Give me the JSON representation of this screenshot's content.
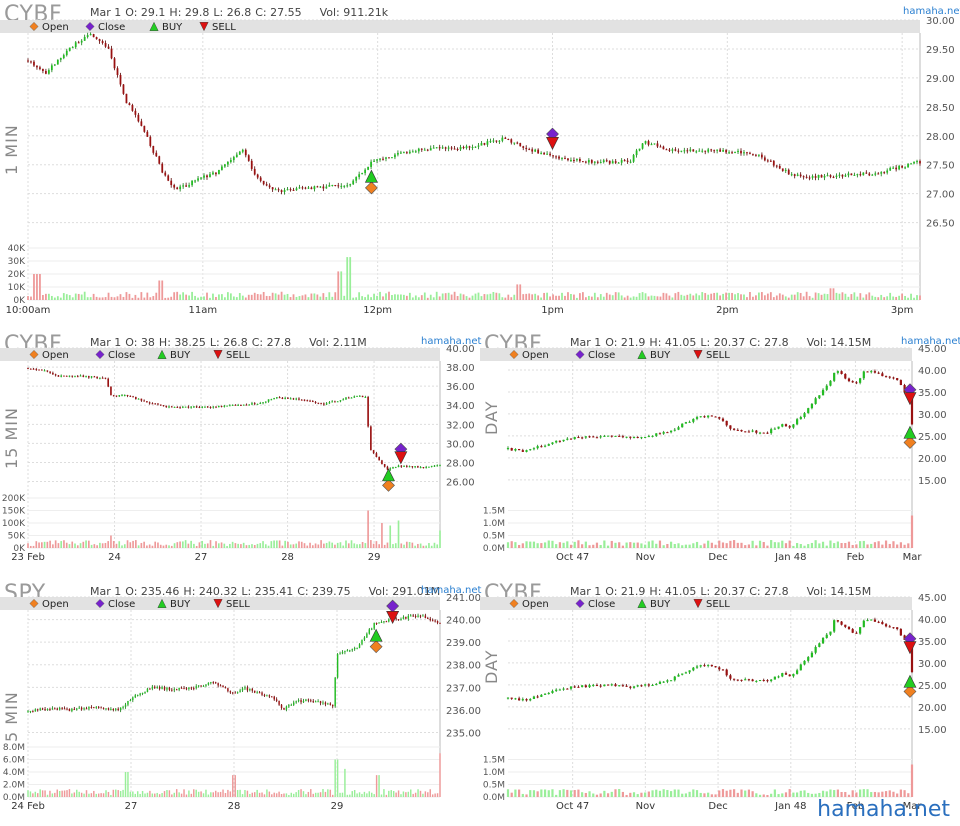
{
  "legend": {
    "open": "Open",
    "close": "Close",
    "buy": "BUY",
    "sell": "SELL"
  },
  "colors": {
    "up_candle": "#22bb22",
    "down_candle": "#991111",
    "up_volume": "#99ee99",
    "down_volume": "#ee9999",
    "open_marker": "#f08020",
    "close_marker": "#7722cc",
    "buy_marker": "#22cc22",
    "sell_marker": "#dd1111",
    "grid": "#dddddd",
    "legend_bg": "#e2e2e2"
  },
  "footer_brand": "hamaha.net",
  "chart_data": [
    {
      "id": "p1",
      "type": "candlestick",
      "ticker": "CYBF",
      "interval": "1 MIN",
      "ohlc": {
        "date": "Mar 1",
        "o": "O: 29.1",
        "h": "H: 29.8",
        "l": "L: 26.8",
        "c": "C: 27.55",
        "vol": "Vol: 911.21k"
      },
      "brand": "hamaha.net",
      "ylim": [
        26.2,
        30.0
      ],
      "y_ticks": [
        "30.00",
        "29.50",
        "29.00",
        "28.50",
        "28.00",
        "27.50",
        "27.00",
        "26.50"
      ],
      "y_tick_values": [
        30.0,
        29.5,
        29.0,
        28.5,
        28.0,
        27.5,
        27.0,
        26.5
      ],
      "x_ticks": [
        "10:00am",
        "11am",
        "12pm",
        "1pm",
        "2pm",
        "3pm"
      ],
      "x_tick_positions": [
        0,
        0.196,
        0.392,
        0.588,
        0.784,
        0.98
      ],
      "vol_max": 40000,
      "vol_ticks": [
        "40K",
        "30K",
        "20K",
        "10K",
        "0K"
      ],
      "vol_tick_values": [
        40000,
        30000,
        20000,
        10000,
        0
      ],
      "n_bars": 300,
      "path": [
        [
          0,
          29.3
        ],
        [
          0.02,
          29.1
        ],
        [
          0.05,
          29.55
        ],
        [
          0.07,
          29.75
        ],
        [
          0.09,
          29.5
        ],
        [
          0.11,
          28.6
        ],
        [
          0.13,
          28.1
        ],
        [
          0.15,
          27.4
        ],
        [
          0.165,
          27.05
        ],
        [
          0.19,
          27.25
        ],
        [
          0.21,
          27.35
        ],
        [
          0.24,
          27.75
        ],
        [
          0.26,
          27.2
        ],
        [
          0.28,
          27.05
        ],
        [
          0.32,
          27.1
        ],
        [
          0.36,
          27.15
        ],
        [
          0.385,
          27.55
        ],
        [
          0.43,
          27.75
        ],
        [
          0.49,
          27.8
        ],
        [
          0.535,
          27.95
        ],
        [
          0.565,
          27.75
        ],
        [
          0.6,
          27.6
        ],
        [
          0.64,
          27.55
        ],
        [
          0.675,
          27.55
        ],
        [
          0.69,
          27.9
        ],
        [
          0.72,
          27.75
        ],
        [
          0.78,
          27.75
        ],
        [
          0.82,
          27.65
        ],
        [
          0.86,
          27.3
        ],
        [
          0.9,
          27.3
        ],
        [
          0.95,
          27.35
        ],
        [
          1.0,
          27.55
        ]
      ],
      "noise": 0.06,
      "vol_spikes": [
        [
          0.01,
          20000
        ],
        [
          0.36,
          33000
        ],
        [
          0.35,
          22000
        ],
        [
          0.15,
          15000
        ],
        [
          0.55,
          12000
        ],
        [
          0.9,
          9000
        ]
      ],
      "markers": [
        {
          "kind": "open",
          "x": 0.385,
          "y": 27.1
        },
        {
          "kind": "buy",
          "x": 0.385,
          "y": 27.3
        },
        {
          "kind": "close",
          "x": 0.588,
          "y": 28.03
        },
        {
          "kind": "sell",
          "x": 0.588,
          "y": 27.87
        }
      ]
    },
    {
      "id": "p2",
      "type": "candlestick",
      "ticker": "CYBF",
      "interval": "15 MIN",
      "ohlc": {
        "date": "Mar 1",
        "o": "O: 38",
        "h": "H: 38.25",
        "l": "L: 26.8",
        "c": "C: 27.8",
        "vol": "Vol: 2.11M"
      },
      "brand": "hamaha.net",
      "ylim": [
        24.8,
        40.0
      ],
      "y_ticks": [
        "40.00",
        "38.00",
        "36.00",
        "34.00",
        "32.00",
        "30.00",
        "28.00",
        "26.00"
      ],
      "y_tick_values": [
        40,
        38,
        36,
        34,
        32,
        30,
        28,
        26
      ],
      "x_ticks": [
        "23 Feb",
        "24",
        "27",
        "28",
        "29"
      ],
      "x_tick_positions": [
        0.0,
        0.21,
        0.42,
        0.63,
        0.84
      ],
      "vol_max": 200000,
      "vol_ticks": [
        "200K",
        "150K",
        "100K",
        "50K",
        "0K"
      ],
      "vol_tick_values": [
        200000,
        150000,
        100000,
        50000,
        0
      ],
      "n_bars": 150,
      "path": [
        [
          0,
          37.9
        ],
        [
          0.04,
          37.6
        ],
        [
          0.07,
          37.0
        ],
        [
          0.12,
          37.1
        ],
        [
          0.19,
          36.8
        ],
        [
          0.2,
          35.0
        ],
        [
          0.24,
          35.0
        ],
        [
          0.3,
          34.2
        ],
        [
          0.34,
          33.8
        ],
        [
          0.45,
          33.8
        ],
        [
          0.56,
          34.2
        ],
        [
          0.6,
          34.8
        ],
        [
          0.66,
          34.6
        ],
        [
          0.72,
          34.1
        ],
        [
          0.76,
          34.6
        ],
        [
          0.8,
          35.0
        ],
        [
          0.82,
          34.8
        ],
        [
          0.825,
          32.0
        ],
        [
          0.83,
          29.5
        ],
        [
          0.85,
          28.3
        ],
        [
          0.87,
          27.3
        ],
        [
          0.9,
          27.6
        ],
        [
          0.93,
          27.6
        ],
        [
          0.96,
          27.4
        ],
        [
          1.0,
          27.8
        ]
      ],
      "noise": 0.18,
      "vol_spikes": [
        [
          0.825,
          150000
        ],
        [
          0.86,
          100000
        ],
        [
          0.88,
          90000
        ],
        [
          0.9,
          110000
        ],
        [
          0.2,
          50000
        ],
        [
          0.6,
          30000
        ],
        [
          1.0,
          70000
        ]
      ],
      "markers": [
        {
          "kind": "open",
          "x": 0.875,
          "y": 25.6
        },
        {
          "kind": "buy",
          "x": 0.875,
          "y": 26.7
        },
        {
          "kind": "close",
          "x": 0.905,
          "y": 29.4
        },
        {
          "kind": "sell",
          "x": 0.905,
          "y": 28.5
        }
      ]
    },
    {
      "id": "p3",
      "type": "candlestick",
      "ticker": "CYBF",
      "interval": "DAY",
      "ohlc": {
        "date": "Mar 1",
        "o": "O: 21.9",
        "h": "H: 41.05",
        "l": "L: 20.37",
        "c": "C: 27.8",
        "vol": "Vol: 14.15M"
      },
      "brand": "hamaha.net",
      "ylim": [
        12.0,
        45.0
      ],
      "y_ticks": [
        "45.00",
        "40.00",
        "35.00",
        "30.00",
        "25.00",
        "20.00",
        "15.00"
      ],
      "y_tick_values": [
        45,
        40,
        35,
        30,
        25,
        20,
        15
      ],
      "x_ticks": [
        "Oct 47",
        "Nov",
        "Dec",
        "Jan 48",
        "Feb",
        "Mar"
      ],
      "x_tick_positions": [
        0.16,
        0.34,
        0.52,
        0.7,
        0.86,
        1.0
      ],
      "vol_max": 2000000,
      "vol_ticks": [
        "1.5M",
        "1.0M",
        "0.5M",
        "0.0M"
      ],
      "vol_tick_values": [
        1500000,
        1000000,
        500000,
        0
      ],
      "n_bars": 110,
      "path": [
        [
          0,
          22.0
        ],
        [
          0.04,
          21.5
        ],
        [
          0.08,
          22.6
        ],
        [
          0.14,
          24.3
        ],
        [
          0.2,
          24.8
        ],
        [
          0.26,
          25.0
        ],
        [
          0.3,
          24.5
        ],
        [
          0.36,
          25.2
        ],
        [
          0.4,
          26.0
        ],
        [
          0.43,
          27.5
        ],
        [
          0.47,
          29.2
        ],
        [
          0.5,
          29.5
        ],
        [
          0.53,
          28.5
        ],
        [
          0.55,
          26.5
        ],
        [
          0.6,
          26.0
        ],
        [
          0.64,
          25.8
        ],
        [
          0.68,
          27.5
        ],
        [
          0.7,
          27.0
        ],
        [
          0.74,
          31.0
        ],
        [
          0.78,
          35.5
        ],
        [
          0.8,
          37.5
        ],
        [
          0.81,
          40.2
        ],
        [
          0.83,
          38.5
        ],
        [
          0.86,
          36.5
        ],
        [
          0.88,
          39.5
        ],
        [
          0.9,
          40.0
        ],
        [
          0.93,
          38.5
        ],
        [
          0.96,
          38.2
        ],
        [
          0.99,
          34.0
        ],
        [
          1.0,
          27.8
        ]
      ],
      "noise": 0.5,
      "vol_spikes": [
        [
          1.0,
          1300000
        ],
        [
          0.78,
          250000
        ],
        [
          0.8,
          300000
        ],
        [
          0.83,
          200000
        ]
      ],
      "markers": [
        {
          "kind": "open",
          "x": 0.995,
          "y": 23.5
        },
        {
          "kind": "buy",
          "x": 0.995,
          "y": 25.8
        },
        {
          "kind": "close",
          "x": 0.995,
          "y": 35.5
        },
        {
          "kind": "sell",
          "x": 0.995,
          "y": 33.5
        }
      ]
    },
    {
      "id": "p4",
      "type": "candlestick",
      "ticker": "SPY",
      "interval": "5 MIN",
      "ohlc": {
        "date": "Mar 1",
        "o": "O: 235.46",
        "h": "H: 240.32",
        "l": "L: 235.41",
        "c": "C: 239.75",
        "vol": "Vol: 291.01M"
      },
      "brand": "hamaha.net",
      "ylim": [
        234.8,
        241.0
      ],
      "y_ticks": [
        "241.00",
        "240.00",
        "239.00",
        "238.00",
        "237.00",
        "236.00",
        "235.00"
      ],
      "y_tick_values": [
        241,
        240,
        239,
        238,
        237,
        236,
        235
      ],
      "x_ticks": [
        "24 Feb",
        "27",
        "28",
        "29"
      ],
      "x_tick_positions": [
        0.0,
        0.25,
        0.5,
        0.75
      ],
      "vol_max": 8000000,
      "vol_ticks": [
        "8.0M",
        "6.0M",
        "4.0M",
        "2.0M",
        "0.0M"
      ],
      "vol_tick_values": [
        8000000,
        6000000,
        4000000,
        2000000,
        0
      ],
      "n_bars": 170,
      "path": [
        [
          0,
          235.9
        ],
        [
          0.05,
          236.1
        ],
        [
          0.1,
          236.0
        ],
        [
          0.15,
          236.1
        ],
        [
          0.22,
          236.0
        ],
        [
          0.25,
          236.5
        ],
        [
          0.3,
          237.0
        ],
        [
          0.35,
          236.9
        ],
        [
          0.4,
          237.0
        ],
        [
          0.45,
          237.2
        ],
        [
          0.5,
          236.7
        ],
        [
          0.52,
          237.0
        ],
        [
          0.6,
          236.5
        ],
        [
          0.62,
          236.0
        ],
        [
          0.65,
          236.4
        ],
        [
          0.7,
          236.4
        ],
        [
          0.74,
          236.2
        ],
        [
          0.75,
          238.4
        ],
        [
          0.8,
          238.8
        ],
        [
          0.82,
          239.3
        ],
        [
          0.84,
          239.8
        ],
        [
          0.88,
          240.0
        ],
        [
          0.92,
          240.1
        ],
        [
          0.95,
          240.2
        ],
        [
          1.0,
          239.8
        ]
      ],
      "noise": 0.12,
      "vol_spikes": [
        [
          1.0,
          7000000
        ],
        [
          0.75,
          6000000
        ],
        [
          0.24,
          4000000
        ],
        [
          0.5,
          3500000
        ],
        [
          0.77,
          4500000
        ],
        [
          0.85,
          3500000
        ]
      ],
      "markers": [
        {
          "kind": "open",
          "x": 0.845,
          "y": 238.8
        },
        {
          "kind": "buy",
          "x": 0.845,
          "y": 239.3
        },
        {
          "kind": "close",
          "x": 0.885,
          "y": 240.6
        },
        {
          "kind": "sell",
          "x": 0.885,
          "y": 240.1
        }
      ]
    },
    {
      "id": "p5",
      "type": "candlestick",
      "ticker": "CYBF",
      "interval": "DAY",
      "ohlc": {
        "date": "Mar 1",
        "o": "O: 21.9",
        "h": "H: 41.05",
        "l": "L: 20.37",
        "c": "C: 27.8",
        "vol": "Vol: 14.15M"
      },
      "brand": "hamaha.net",
      "ylim": [
        12.0,
        45.0
      ],
      "y_ticks": [
        "45.00",
        "40.00",
        "35.00",
        "30.00",
        "25.00",
        "20.00",
        "15.00"
      ],
      "y_tick_values": [
        45,
        40,
        35,
        30,
        25,
        20,
        15
      ],
      "x_ticks": [
        "Oct 47",
        "Nov",
        "Dec",
        "Jan 48",
        "Feb",
        "Mar"
      ],
      "x_tick_positions": [
        0.16,
        0.34,
        0.52,
        0.7,
        0.86,
        1.0
      ],
      "vol_max": 2000000,
      "vol_ticks": [
        "1.5M",
        "1.0M",
        "0.5M",
        "0.0M"
      ],
      "vol_tick_values": [
        1500000,
        1000000,
        500000,
        0
      ],
      "n_bars": 110,
      "path": [
        [
          0,
          22.0
        ],
        [
          0.04,
          21.5
        ],
        [
          0.08,
          22.6
        ],
        [
          0.14,
          24.3
        ],
        [
          0.2,
          24.8
        ],
        [
          0.26,
          25.0
        ],
        [
          0.3,
          24.5
        ],
        [
          0.36,
          25.2
        ],
        [
          0.4,
          26.0
        ],
        [
          0.43,
          27.5
        ],
        [
          0.47,
          29.2
        ],
        [
          0.5,
          29.5
        ],
        [
          0.53,
          28.5
        ],
        [
          0.55,
          26.5
        ],
        [
          0.6,
          26.0
        ],
        [
          0.64,
          25.8
        ],
        [
          0.68,
          27.5
        ],
        [
          0.7,
          27.0
        ],
        [
          0.74,
          31.0
        ],
        [
          0.78,
          35.5
        ],
        [
          0.8,
          37.5
        ],
        [
          0.81,
          40.2
        ],
        [
          0.83,
          38.5
        ],
        [
          0.86,
          36.5
        ],
        [
          0.88,
          39.5
        ],
        [
          0.9,
          40.0
        ],
        [
          0.93,
          38.5
        ],
        [
          0.96,
          38.2
        ],
        [
          0.99,
          34.0
        ],
        [
          1.0,
          27.8
        ]
      ],
      "noise": 0.5,
      "vol_spikes": [
        [
          1.0,
          1300000
        ],
        [
          0.78,
          250000
        ],
        [
          0.8,
          300000
        ],
        [
          0.83,
          200000
        ]
      ],
      "markers": [
        {
          "kind": "open",
          "x": 0.995,
          "y": 23.5
        },
        {
          "kind": "buy",
          "x": 0.995,
          "y": 25.8
        },
        {
          "kind": "close",
          "x": 0.995,
          "y": 35.5
        },
        {
          "kind": "sell",
          "x": 0.995,
          "y": 33.5
        }
      ]
    }
  ]
}
